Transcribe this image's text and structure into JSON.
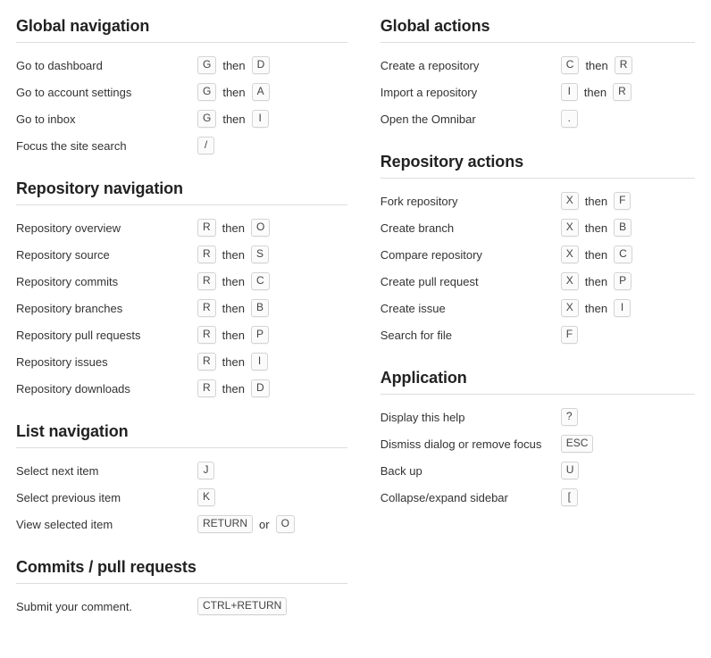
{
  "columns": {
    "left": [
      {
        "heading": "Global navigation",
        "rows": [
          {
            "label": "Go to dashboard",
            "keys": [
              "G"
            ],
            "connector": "then",
            "keys2": [
              "D"
            ]
          },
          {
            "label": "Go to account settings",
            "keys": [
              "G"
            ],
            "connector": "then",
            "keys2": [
              "A"
            ]
          },
          {
            "label": "Go to inbox",
            "keys": [
              "G"
            ],
            "connector": "then",
            "keys2": [
              "I"
            ]
          },
          {
            "label": "Focus the site search",
            "keys": [
              "/"
            ],
            "connector": "",
            "keys2": []
          }
        ]
      },
      {
        "heading": "Repository navigation",
        "rows": [
          {
            "label": "Repository overview",
            "keys": [
              "R"
            ],
            "connector": "then",
            "keys2": [
              "O"
            ]
          },
          {
            "label": "Repository source",
            "keys": [
              "R"
            ],
            "connector": "then",
            "keys2": [
              "S"
            ]
          },
          {
            "label": "Repository commits",
            "keys": [
              "R"
            ],
            "connector": "then",
            "keys2": [
              "C"
            ]
          },
          {
            "label": "Repository branches",
            "keys": [
              "R"
            ],
            "connector": "then",
            "keys2": [
              "B"
            ]
          },
          {
            "label": "Repository pull requests",
            "keys": [
              "R"
            ],
            "connector": "then",
            "keys2": [
              "P"
            ]
          },
          {
            "label": "Repository issues",
            "keys": [
              "R"
            ],
            "connector": "then",
            "keys2": [
              "I"
            ]
          },
          {
            "label": "Repository downloads",
            "keys": [
              "R"
            ],
            "connector": "then",
            "keys2": [
              "D"
            ]
          }
        ]
      },
      {
        "heading": "List navigation",
        "rows": [
          {
            "label": "Select next item",
            "keys": [
              "J"
            ],
            "connector": "",
            "keys2": []
          },
          {
            "label": "Select previous item",
            "keys": [
              "K"
            ],
            "connector": "",
            "keys2": []
          },
          {
            "label": "View selected item",
            "keys": [
              "RETURN"
            ],
            "connector": "or",
            "keys2": [
              "O"
            ]
          }
        ]
      },
      {
        "heading": "Commits / pull requests",
        "rows": [
          {
            "label": "Submit your comment.",
            "keys": [
              "CTRL+RETURN"
            ],
            "connector": "",
            "keys2": []
          }
        ]
      }
    ],
    "right": [
      {
        "heading": "Global actions",
        "rows": [
          {
            "label": "Create a repository",
            "keys": [
              "C"
            ],
            "connector": "then",
            "keys2": [
              "R"
            ]
          },
          {
            "label": "Import a repository",
            "keys": [
              "I"
            ],
            "connector": "then",
            "keys2": [
              "R"
            ]
          },
          {
            "label": "Open the Omnibar",
            "keys": [
              "."
            ],
            "connector": "",
            "keys2": []
          }
        ]
      },
      {
        "heading": "Repository actions",
        "rows": [
          {
            "label": "Fork repository",
            "keys": [
              "X"
            ],
            "connector": "then",
            "keys2": [
              "F"
            ]
          },
          {
            "label": "Create branch",
            "keys": [
              "X"
            ],
            "connector": "then",
            "keys2": [
              "B"
            ]
          },
          {
            "label": "Compare repository",
            "keys": [
              "X"
            ],
            "connector": "then",
            "keys2": [
              "C"
            ]
          },
          {
            "label": "Create pull request",
            "keys": [
              "X"
            ],
            "connector": "then",
            "keys2": [
              "P"
            ]
          },
          {
            "label": "Create issue",
            "keys": [
              "X"
            ],
            "connector": "then",
            "keys2": [
              "I"
            ]
          },
          {
            "label": "Search for file",
            "keys": [
              "F"
            ],
            "connector": "",
            "keys2": []
          }
        ]
      },
      {
        "heading": "Application",
        "rows": [
          {
            "label": "Display this help",
            "keys": [
              "?"
            ],
            "connector": "",
            "keys2": []
          },
          {
            "label": "Dismiss dialog or remove focus",
            "keys": [
              "ESC"
            ],
            "connector": "",
            "keys2": []
          },
          {
            "label": "Back up",
            "keys": [
              "U"
            ],
            "connector": "",
            "keys2": []
          },
          {
            "label": "Collapse/expand sidebar",
            "keys": [
              "["
            ],
            "connector": "",
            "keys2": []
          }
        ]
      }
    ]
  },
  "colors": {
    "heading": "#222222",
    "text": "#333333",
    "rule": "#dddddd",
    "keycap_border": "#d4d4d4",
    "keycap_bg": "#fbfbfb",
    "keycap_text": "#444444",
    "background": "#ffffff"
  }
}
